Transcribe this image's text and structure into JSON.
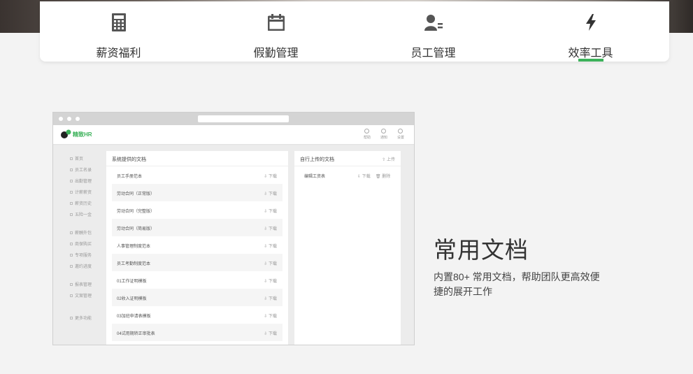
{
  "tabs": [
    {
      "label": "薪资福利",
      "icon": "calculator-icon",
      "active": false
    },
    {
      "label": "假勤管理",
      "icon": "calendar-icon",
      "active": false
    },
    {
      "label": "员工管理",
      "icon": "employee-icon",
      "active": false
    },
    {
      "label": "效率工具",
      "icon": "lightning-icon",
      "active": true
    }
  ],
  "accent_color": "#3cb25a",
  "mock": {
    "logo_text": "精致HR",
    "header_actions": [
      "帮助",
      "通知",
      "设置"
    ],
    "sidebar": [
      "首页",
      "员工名录",
      "出勤管理",
      "计薪薪资",
      "薪资历史",
      "五险一金",
      "薪酬外包",
      "商保购买",
      "专项服务",
      "邀约进度",
      "报表管理",
      "文案管理",
      "更多功能"
    ],
    "system_docs": {
      "title": "系统提供的文档",
      "download_label": "⇩ 下载",
      "rows": [
        "员工手册范本",
        "劳动合同（正常版）",
        "劳动合同（完整版）",
        "劳动合同（简易版）",
        "人事管理制度范本",
        "员工考勤制度范本",
        "01工作证明模板",
        "02收入证明模板",
        "03加班申请表模板",
        "04试用期转正审批表"
      ]
    },
    "own_docs": {
      "title": "自行上传的文档",
      "upload_label": "⇧ 上传",
      "rows": [
        {
          "name": "编辑工资表",
          "download": "⇩ 下载",
          "delete": "🗑 删除"
        }
      ]
    }
  },
  "feature": {
    "title": "常用文档",
    "description": "内置80+ 常用文档，帮助团队更高效便捷的展开工作"
  }
}
